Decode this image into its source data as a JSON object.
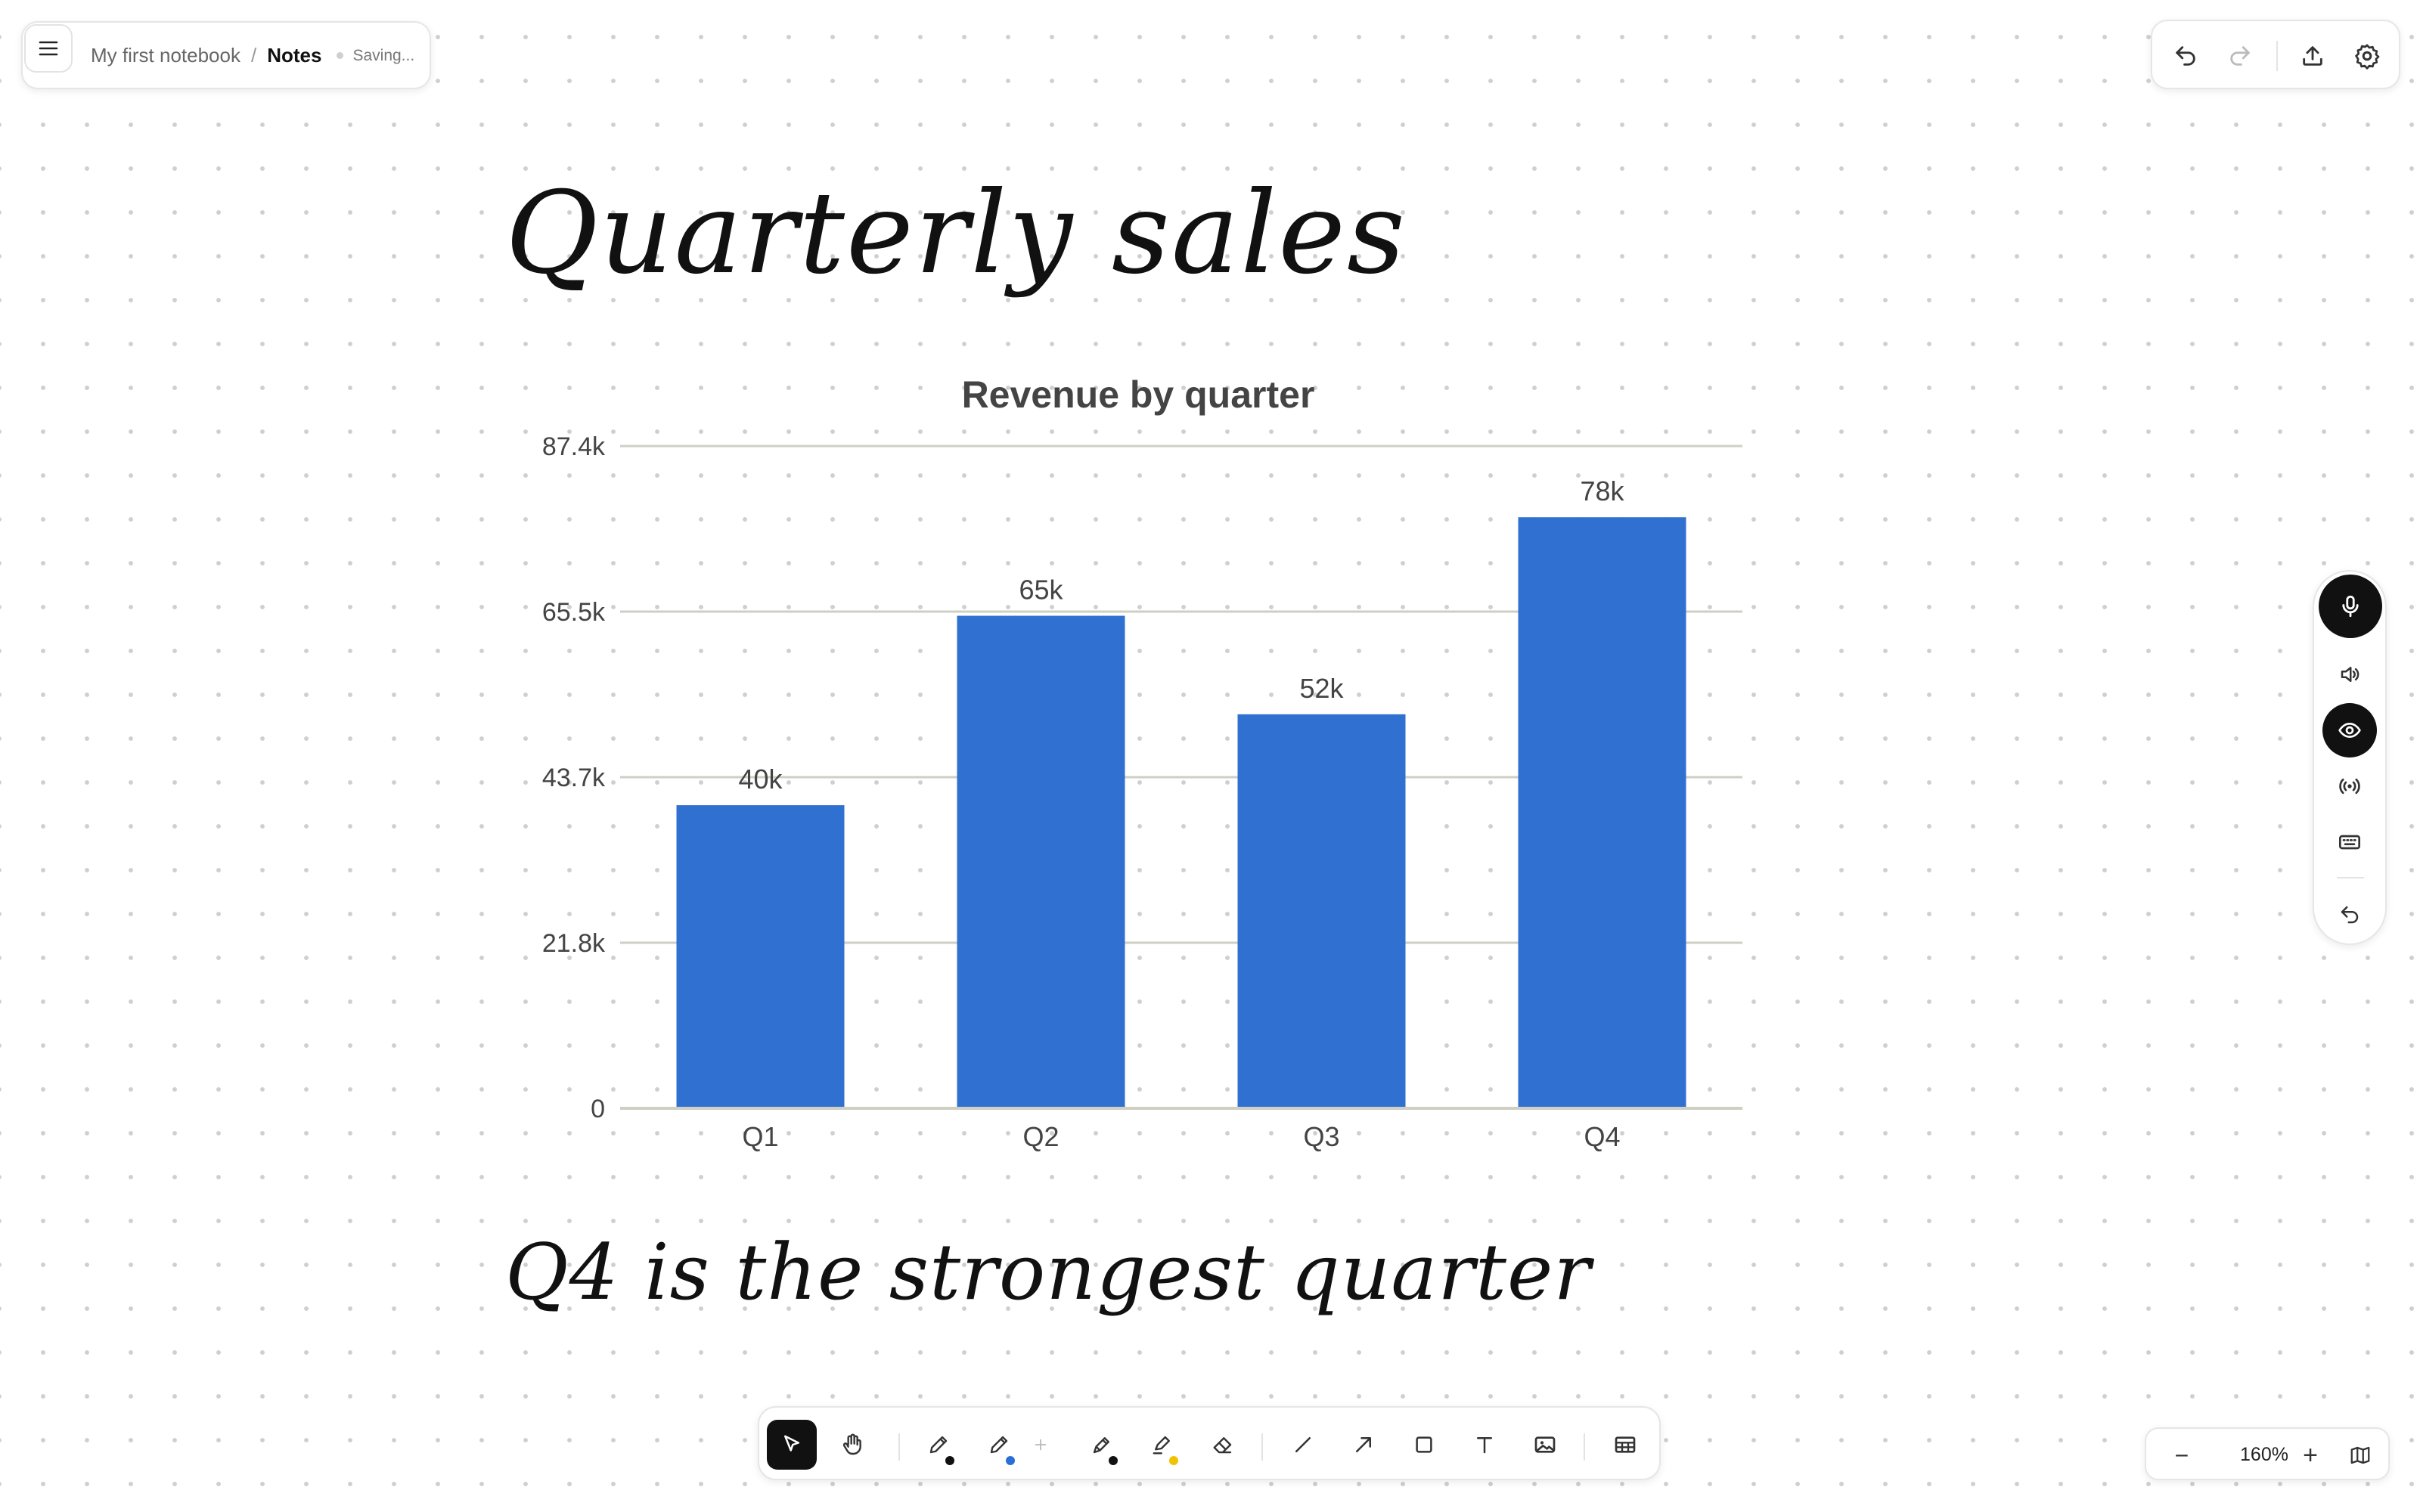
{
  "breadcrumb": {
    "notebook": "My first notebook",
    "separator": "/",
    "page": "Notes",
    "status": "Saving..."
  },
  "icons": {
    "menu": "menu-icon",
    "undo": "undo-icon",
    "redo": "redo-icon",
    "share": "share-upload-icon",
    "settings": "gear-icon",
    "mic": "microphone-icon",
    "speaker": "speaker-icon",
    "eye": "eye-icon",
    "broadcast": "broadcast-icon",
    "keyboard": "keyboard-icon",
    "side_undo": "undo-icon"
  },
  "handwriting": {
    "title": "Quarterly sales",
    "note": "Q4 is the strongest quarter"
  },
  "chart_data": {
    "type": "bar",
    "title": "Revenue by quarter",
    "categories": [
      "Q1",
      "Q2",
      "Q3",
      "Q4"
    ],
    "values": [
      40000,
      65000,
      52000,
      78000
    ],
    "value_labels": [
      "40k",
      "65k",
      "52k",
      "78k"
    ],
    "y_ticks": [
      0,
      21850,
      43700,
      65550,
      87400
    ],
    "y_tick_labels": [
      "0",
      "21.8k",
      "43.7k",
      "65.5k",
      "87.4k"
    ],
    "ylim": [
      0,
      87400
    ],
    "grid": true,
    "bar_color": "#3070d0",
    "grid_color": "#cfcfc4",
    "text_color": "#444444"
  },
  "bottom_toolbar": {
    "tools": [
      "select",
      "hand",
      "pen",
      "pen",
      "add-pen",
      "marker",
      "highlighter",
      "eraser",
      "line",
      "arrow",
      "rectangle",
      "text",
      "image",
      "table"
    ],
    "pen_colors": [
      "#111111",
      "#2a6fd6",
      "#111111",
      "#f2c200"
    ]
  },
  "zoom": {
    "minus": "−",
    "level": "160%",
    "plus": "+"
  },
  "colors": {
    "accent_dark": "#111111",
    "dot_grid": "#cfcfcf"
  }
}
